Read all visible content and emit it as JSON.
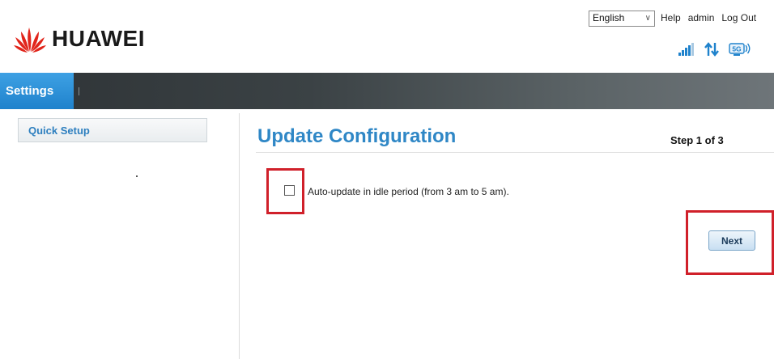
{
  "brand": {
    "name": "HUAWEI"
  },
  "header": {
    "language": "English",
    "links": {
      "help": "Help",
      "user": "admin",
      "logout": "Log Out"
    },
    "network_badge": "5G"
  },
  "nav": {
    "active_tab": "Settings"
  },
  "sidebar": {
    "items": [
      {
        "label": "Quick Setup"
      }
    ]
  },
  "main": {
    "title": "Update Configuration",
    "step": "Step 1 of 3",
    "auto_update": {
      "label": "Auto-update in idle period (from 3 am to 5 am).",
      "checked": false
    },
    "next_label": "Next"
  },
  "colors": {
    "accent": "#2f87c6",
    "highlight": "#d0202a",
    "nav_active": "#1f82cc"
  }
}
